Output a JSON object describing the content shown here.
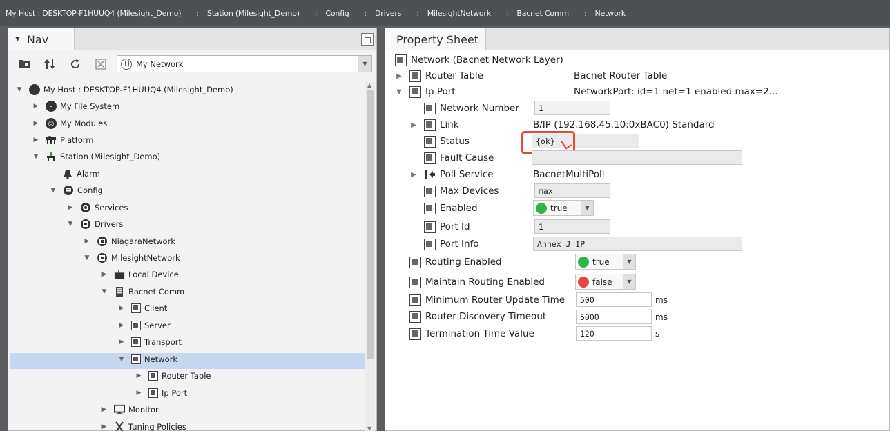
{
  "breadcrumb": [
    "My Host : DESKTOP-F1HUUQ4 (Milesight_Demo)",
    "Station (Milesight_Demo)",
    "Config",
    "Drivers",
    "MilesightNetwork",
    "Bacnet Comm",
    "Network"
  ],
  "crumb_separator": ":",
  "nav": {
    "tab_label": "Nav",
    "network_select": "My Network",
    "tree": [
      {
        "label": "My Host : DESKTOP-F1HUUQ4 (Milesight_Demo)",
        "icon": "host-icon",
        "expanded": true
      },
      {
        "label": "My File System",
        "icon": "file-system-icon"
      },
      {
        "label": "My Modules",
        "icon": "modules-icon"
      },
      {
        "label": "Platform",
        "icon": "platform-icon"
      },
      {
        "label": "Station (Milesight_Demo)",
        "icon": "station-icon",
        "expanded": true
      },
      {
        "label": "Alarm",
        "icon": "bell-icon"
      },
      {
        "label": "Config",
        "icon": "config-icon",
        "expanded": true
      },
      {
        "label": "Services",
        "icon": "services-icon"
      },
      {
        "label": "Drivers",
        "icon": "drivers-icon",
        "expanded": true
      },
      {
        "label": "NiagaraNetwork",
        "icon": "network-icon"
      },
      {
        "label": "MilesightNetwork",
        "icon": "network-icon",
        "expanded": true
      },
      {
        "label": "Local Device",
        "icon": "device-icon"
      },
      {
        "label": "Bacnet Comm",
        "icon": "comm-icon",
        "expanded": true
      },
      {
        "label": "Client",
        "icon": "component-icon"
      },
      {
        "label": "Server",
        "icon": "component-icon"
      },
      {
        "label": "Transport",
        "icon": "component-icon"
      },
      {
        "label": "Network",
        "icon": "component-icon",
        "expanded": true,
        "selected": true
      },
      {
        "label": "Router Table",
        "icon": "component-icon"
      },
      {
        "label": "Ip Port",
        "icon": "component-icon"
      },
      {
        "label": "Monitor",
        "icon": "monitor-icon"
      },
      {
        "label": "Tuning Policies",
        "icon": "tuning-icon"
      }
    ]
  },
  "property_sheet": {
    "tab_label": "Property Sheet",
    "root_label": "Network  (Bacnet Network Layer)",
    "rows": {
      "router_table": {
        "label": "Router Table",
        "value": "Bacnet Router Table"
      },
      "ip_port": {
        "label": "Ip Port",
        "value": "NetworkPort: id=1 net=1 enabled max=2..."
      },
      "network_number": {
        "label": "Network Number",
        "value": "1"
      },
      "link": {
        "label": "Link",
        "value": "B/IP (192.168.45.10:0xBAC0) Standard"
      },
      "status": {
        "label": "Status",
        "value": "{ok}"
      },
      "fault_cause": {
        "label": "Fault Cause",
        "value": ""
      },
      "poll_service": {
        "label": "Poll Service",
        "value": "BacnetMultiPoll"
      },
      "max_devices": {
        "label": "Max Devices",
        "value": "max"
      },
      "enabled": {
        "label": "Enabled",
        "value": "true",
        "color": "#2db34a"
      },
      "port_id": {
        "label": "Port Id",
        "value": "1"
      },
      "port_info": {
        "label": "Port Info",
        "value": "Annex J IP"
      },
      "routing_enabled": {
        "label": "Routing Enabled",
        "value": "true",
        "color": "#2db34a"
      },
      "maintain_routing": {
        "label": "Maintain Routing Enabled",
        "value": "false",
        "color": "#e8453e"
      },
      "min_router_update": {
        "label": "Minimum Router Update Time",
        "value": "500",
        "unit": "ms"
      },
      "router_discovery": {
        "label": "Router Discovery Timeout",
        "value": "5000",
        "unit": "ms"
      },
      "termination_time": {
        "label": "Termination Time Value",
        "value": "120",
        "unit": "s"
      }
    }
  },
  "colors": {
    "selection": "#c5d8f1",
    "highlight_box": "#e9463a",
    "true_dot": "#2db34a",
    "false_dot": "#e8453e"
  }
}
